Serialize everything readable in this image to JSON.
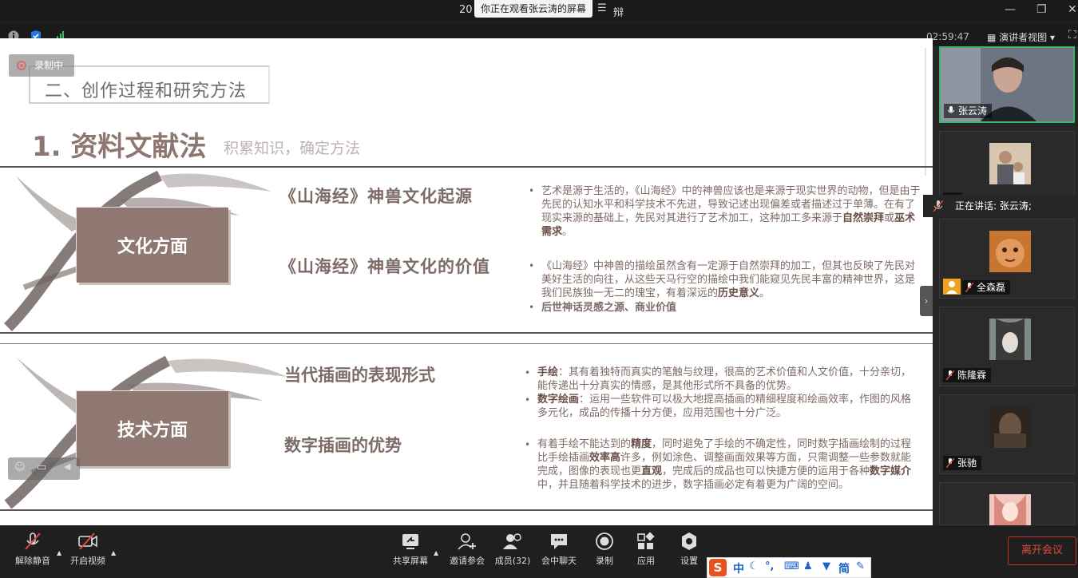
{
  "window": {
    "title_fragment_left": "20",
    "title_fragment_right": "辩",
    "share_notice": "你正在观看张云涛的屏幕",
    "timer": "02:59:47",
    "view_mode": "演讲者视图"
  },
  "recording": {
    "label": "录制中"
  },
  "slide": {
    "section_title": "二、创作过程和研究方法",
    "main_title": "1. 资料文献法",
    "main_subtitle": "积累知识，确定方法",
    "band1": {
      "label": "文化方面",
      "head1": "《山海经》神兽文化起源",
      "head2": "《山海经》神兽文化的价值",
      "p1_a": "艺术是源于生活的，《山海经》中的神兽应该也是来源于现实世界的动物，但是由于先民的认知水平和科学技术不先进，导致记述出现偏差或者描述过于单薄。在有了现实来源的基础上，先民对其进行了艺术加工，这种加工多来源于",
      "p1_b1": "自然崇拜",
      "p1_mid": "或",
      "p1_b2": "巫术需求",
      "p1_end": "。",
      "p2_a": "《山海经》中神兽的描绘虽然含有一定源于自然崇拜的加工，但其也反映了先民对美好生活的向往，从这些天马行空的描绘中我们能窥见先民丰富的精神世界，这是我们民族独一无二的瑰宝，有着深远的",
      "p2_b": "历史意义",
      "p2_end": "。",
      "p3": "后世神话灵感之源、商业价值"
    },
    "band2": {
      "label": "技术方面",
      "head1": "当代插画的表现形式",
      "head2": "数字插画的优势",
      "p1_b": "手绘",
      "p1": "：其有着独特而真实的笔触与纹理，很高的艺术价值和人文价值，十分亲切，能传递出十分真实的情感，是其他形式所不具备的优势。",
      "p2_b": "数字绘画",
      "p2": "：运用一些软件可以极大地提高插画的精细程度和绘画效率，作图的风格多元化，成品的传播十分方便，应用范围也十分广泛。",
      "p3_a": "有着手绘不能达到的",
      "p3_b1": "精度",
      "p3_c": "，同时避免了手绘的不确定性，同时数字插画绘制的过程比手绘插画",
      "p3_b2": "效率高",
      "p3_d": "许多，例如涂色、调整画面效果等方面，只需调整一些参数就能完成，图像的表现也更",
      "p3_b3": "直观",
      "p3_e": "，完成后的成品也可以快捷方便的运用于各种",
      "p3_b4": "数字媒介",
      "p3_f": "中，并且随着科学技术的进步，数字插画必定有着更为广阔的空间。"
    }
  },
  "participants": [
    {
      "name": "张云涛"
    },
    {
      "name": ""
    },
    {
      "name": "全森磊"
    },
    {
      "name": "陈隆霖"
    },
    {
      "name": "张驰"
    },
    {
      "name": ""
    }
  ],
  "speaking": {
    "text": "正在讲话: 张云涛;"
  },
  "toolbar": {
    "mute": "解除静音",
    "video": "开启视频",
    "share": "共享屏幕",
    "invite": "邀请参会",
    "members": "成员(32)",
    "chat": "会中聊天",
    "record": "录制",
    "apps": "应用",
    "settings": "设置",
    "leave": "离开会议"
  },
  "ime": {
    "lang": "中",
    "mode": "简"
  }
}
